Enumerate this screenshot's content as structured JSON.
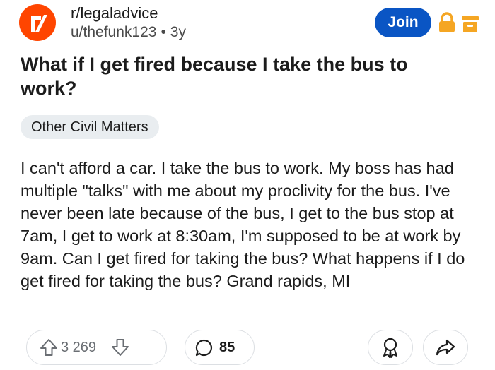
{
  "post": {
    "subreddit": "r/legaladvice",
    "author": "u/thefunk123",
    "separator": "•",
    "age": "3y",
    "join_label": "Join",
    "title": "What if I get fired because I take the bus to work?",
    "flair": "Other Civil Matters",
    "body": "I can't afford a car. I take the bus to work. My boss has had multiple \"talks\" with me about my proclivity for the bus. I've never been late because of the bus, I get to the bus stop at 7am, I get to work at 8:30am, I'm supposed to be at work by 9am. Can I get fired for taking the bus? What happens if I do get fired for taking the bus? Grand rapids, MI"
  },
  "actions": {
    "upvotes": "3 269",
    "comments": "85"
  },
  "colors": {
    "brand": "#ff4500",
    "join_button": "#0a55c4",
    "lock": "#f5a623"
  },
  "icons": [
    "subreddit-logo-icon",
    "lock-icon",
    "archive-icon",
    "upvote-icon",
    "downvote-icon",
    "comment-icon",
    "award-icon",
    "share-icon"
  ]
}
